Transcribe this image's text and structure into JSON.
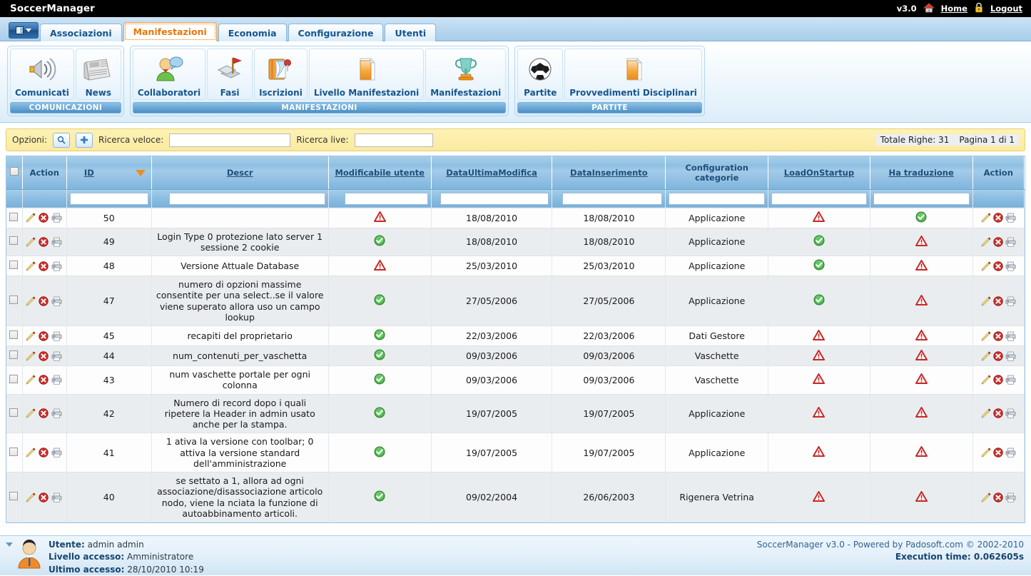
{
  "topbar": {
    "app_title": "SoccerManager",
    "version": "v3.0",
    "home_label": "Home",
    "home_icon": "house-icon",
    "logout_label": "Logout",
    "logout_icon": "lock-icon"
  },
  "tabs": [
    {
      "label": "Associazioni",
      "active": false
    },
    {
      "label": "Manifestazioni",
      "active": true
    },
    {
      "label": "Economia",
      "active": false
    },
    {
      "label": "Configurazione",
      "active": false
    },
    {
      "label": "Utenti",
      "active": false
    }
  ],
  "menu_button": {
    "name": "app-menu-button",
    "icon": "menu-icon"
  },
  "ribbon": [
    {
      "title": "COMUNICAZIONI",
      "items": [
        {
          "label": "Comunicati",
          "icon": "megaphone-icon"
        },
        {
          "label": "News",
          "icon": "newspaper-icon"
        }
      ]
    },
    {
      "title": "MANIFESTAZIONI",
      "items": [
        {
          "label": "Collaboratori",
          "icon": "user-chat-icon"
        },
        {
          "label": "Fasi",
          "icon": "flag-icon"
        },
        {
          "label": "Iscrizioni",
          "icon": "book-pin-icon"
        },
        {
          "label": "Livello Manifestazioni",
          "icon": "folder-icon"
        },
        {
          "label": "Manifestazioni",
          "icon": "trophy-icon"
        }
      ]
    },
    {
      "title": "PARTITE",
      "items": [
        {
          "label": "Partite",
          "icon": "soccer-ball-icon"
        },
        {
          "label": "Provvedimenti Disciplinari",
          "icon": "folder-icon"
        }
      ]
    }
  ],
  "optionsbar": {
    "options_label": "Opzioni:",
    "search_button_icon": "magnifier-icon",
    "add_button_icon": "plus-icon",
    "quick_search_label": "Ricerca veloce:",
    "quick_search_value": "",
    "live_search_label": "Ricerca live:",
    "live_search_value": "",
    "total_rows": "Totale Righe: 31",
    "page_info": "Pagina 1 di 1"
  },
  "table": {
    "columns": [
      {
        "label": "",
        "name": "select-all",
        "sortable": false,
        "type": "checkbox"
      },
      {
        "label": "Action",
        "name": "action-left",
        "sortable": false,
        "filter": false
      },
      {
        "label": "ID",
        "name": "id",
        "sortable": true,
        "sorted": "desc",
        "filter": true
      },
      {
        "label": "Descr",
        "name": "descr",
        "sortable": true,
        "filter": true
      },
      {
        "label": "Modificabile utente",
        "name": "modificabile-utente",
        "sortable": true,
        "filter": true
      },
      {
        "label": "DataUltimaModifica",
        "name": "data-ultima-modifica",
        "sortable": true,
        "filter": true
      },
      {
        "label": "DataInserimento",
        "name": "data-inserimento",
        "sortable": true,
        "filter": true
      },
      {
        "label": "Configuration categorie",
        "name": "configuration-categorie",
        "sortable": false,
        "filter": true
      },
      {
        "label": "LoadOnStartup",
        "name": "load-on-startup",
        "sortable": true,
        "filter": true
      },
      {
        "label": "Ha traduzione",
        "name": "ha-traduzione",
        "sortable": true,
        "filter": true
      },
      {
        "label": "Action",
        "name": "action-right",
        "sortable": false,
        "filter": false
      }
    ],
    "row_icons": {
      "edit": "pencil-icon",
      "delete": "delete-icon",
      "print": "printer-icon",
      "yes": "green-check-icon",
      "no": "red-warning-icon"
    },
    "rows": [
      {
        "id": "50",
        "descr": "",
        "modificabile": false,
        "ultima_modifica": "18/08/2010",
        "inserimento": "18/08/2010",
        "categoria": "Applicazione",
        "loadonstartup": false,
        "traduzione": true
      },
      {
        "id": "49",
        "descr": "Login Type 0 protezione lato server 1 sessione 2 cookie",
        "modificabile": true,
        "ultima_modifica": "18/08/2010",
        "inserimento": "18/08/2010",
        "categoria": "Applicazione",
        "loadonstartup": true,
        "traduzione": false
      },
      {
        "id": "48",
        "descr": "Versione Attuale Database",
        "modificabile": false,
        "ultima_modifica": "25/03/2010",
        "inserimento": "25/03/2010",
        "categoria": "Applicazione",
        "loadonstartup": true,
        "traduzione": false
      },
      {
        "id": "47",
        "descr": "numero di opzioni massime consentite per una select..se il valore viene superato allora uso un campo lookup",
        "modificabile": true,
        "ultima_modifica": "27/05/2006",
        "inserimento": "27/05/2006",
        "categoria": "Applicazione",
        "loadonstartup": true,
        "traduzione": false
      },
      {
        "id": "45",
        "descr": "recapiti del proprietario",
        "modificabile": true,
        "ultima_modifica": "22/03/2006",
        "inserimento": "22/03/2006",
        "categoria": "Dati Gestore",
        "loadonstartup": false,
        "traduzione": false
      },
      {
        "id": "44",
        "descr": "num_contenuti_per_vaschetta",
        "modificabile": true,
        "ultima_modifica": "09/03/2006",
        "inserimento": "09/03/2006",
        "categoria": "Vaschette",
        "loadonstartup": false,
        "traduzione": false
      },
      {
        "id": "43",
        "descr": "num vaschette portale per ogni colonna",
        "modificabile": true,
        "ultima_modifica": "09/03/2006",
        "inserimento": "09/03/2006",
        "categoria": "Vaschette",
        "loadonstartup": false,
        "traduzione": false
      },
      {
        "id": "42",
        "descr": "Numero di record dopo i quali ripetere la Header in admin usato anche per la stampa.",
        "modificabile": true,
        "ultima_modifica": "19/07/2005",
        "inserimento": "19/07/2005",
        "categoria": "Applicazione",
        "loadonstartup": false,
        "traduzione": false
      },
      {
        "id": "41",
        "descr": "1 ativa la versione con toolbar; 0 attiva la versione standard dell'amministrazione",
        "modificabile": true,
        "ultima_modifica": "19/07/2005",
        "inserimento": "19/07/2005",
        "categoria": "Applicazione",
        "loadonstartup": false,
        "traduzione": false
      },
      {
        "id": "40",
        "descr": "se settato a 1, allora ad ogni associazione/disassociazione articolo nodo, viene la nciata la funzione di autoabbinamento articoli.",
        "modificabile": true,
        "ultima_modifica": "09/02/2004",
        "inserimento": "26/06/2003",
        "categoria": "Rigenera Vetrina",
        "loadonstartup": false,
        "traduzione": false
      }
    ]
  },
  "footer": {
    "avatar_icon": "user-avatar-icon",
    "user_label": "Utente:",
    "user_value": "admin admin",
    "level_label": "Livello accesso:",
    "level_value": "Amministratore",
    "last_label": "Ultimo accesso:",
    "last_value": "28/10/2010 10:19",
    "copyright": "SoccerManager v3.0 - Powered by Padosoft.com © 2002-2010",
    "execution": "Execution time: 0.062605s"
  },
  "colors": {
    "accent_orange": "#e8760a",
    "header_blue": "#1f4e79",
    "bar_yellow": "#fbeaa0",
    "ok_green": "#2e9e3e",
    "warn_red": "#cc2222"
  }
}
